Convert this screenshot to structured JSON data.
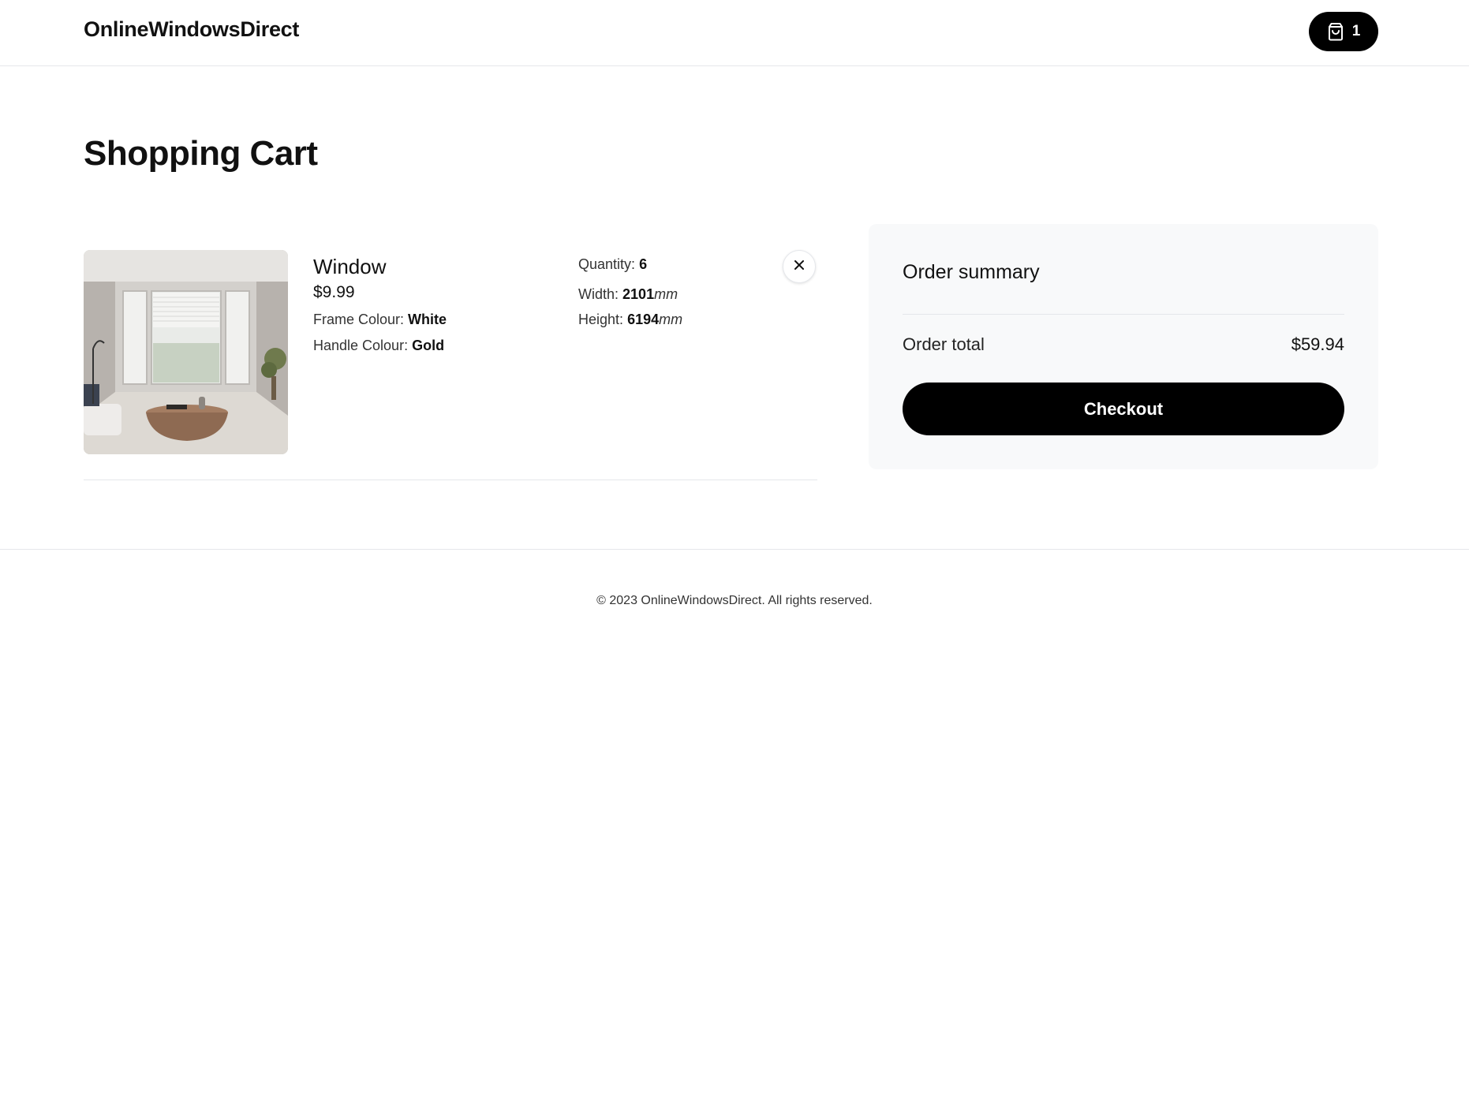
{
  "header": {
    "brand": "OnlineWindowsDirect",
    "cart": {
      "icon": "shopping-bag-icon",
      "count": "1"
    }
  },
  "page": {
    "title": "Shopping Cart"
  },
  "cart_items": [
    {
      "name": "Window",
      "price": "$9.99",
      "frame_colour_label": "Frame Colour:",
      "frame_colour": "White",
      "handle_colour_label": "Handle Colour:",
      "handle_colour": "Gold",
      "quantity_label": "Quantity:",
      "quantity": "6",
      "width_label": "Width:",
      "width": "2101",
      "height_label": "Height:",
      "height": "6194",
      "unit": "mm",
      "image": "living-room-bay-window-photo",
      "remove_icon": "close-icon"
    }
  ],
  "summary": {
    "title": "Order summary",
    "total_label": "Order total",
    "total_value": "$59.94",
    "checkout_label": "Checkout"
  },
  "footer": {
    "copyright": "© 2023 OnlineWindowsDirect. All rights reserved."
  },
  "colors": {
    "primary": "#000000",
    "background": "#ffffff",
    "summary_bg": "#f8f9fa",
    "border": "#e5e7eb"
  }
}
